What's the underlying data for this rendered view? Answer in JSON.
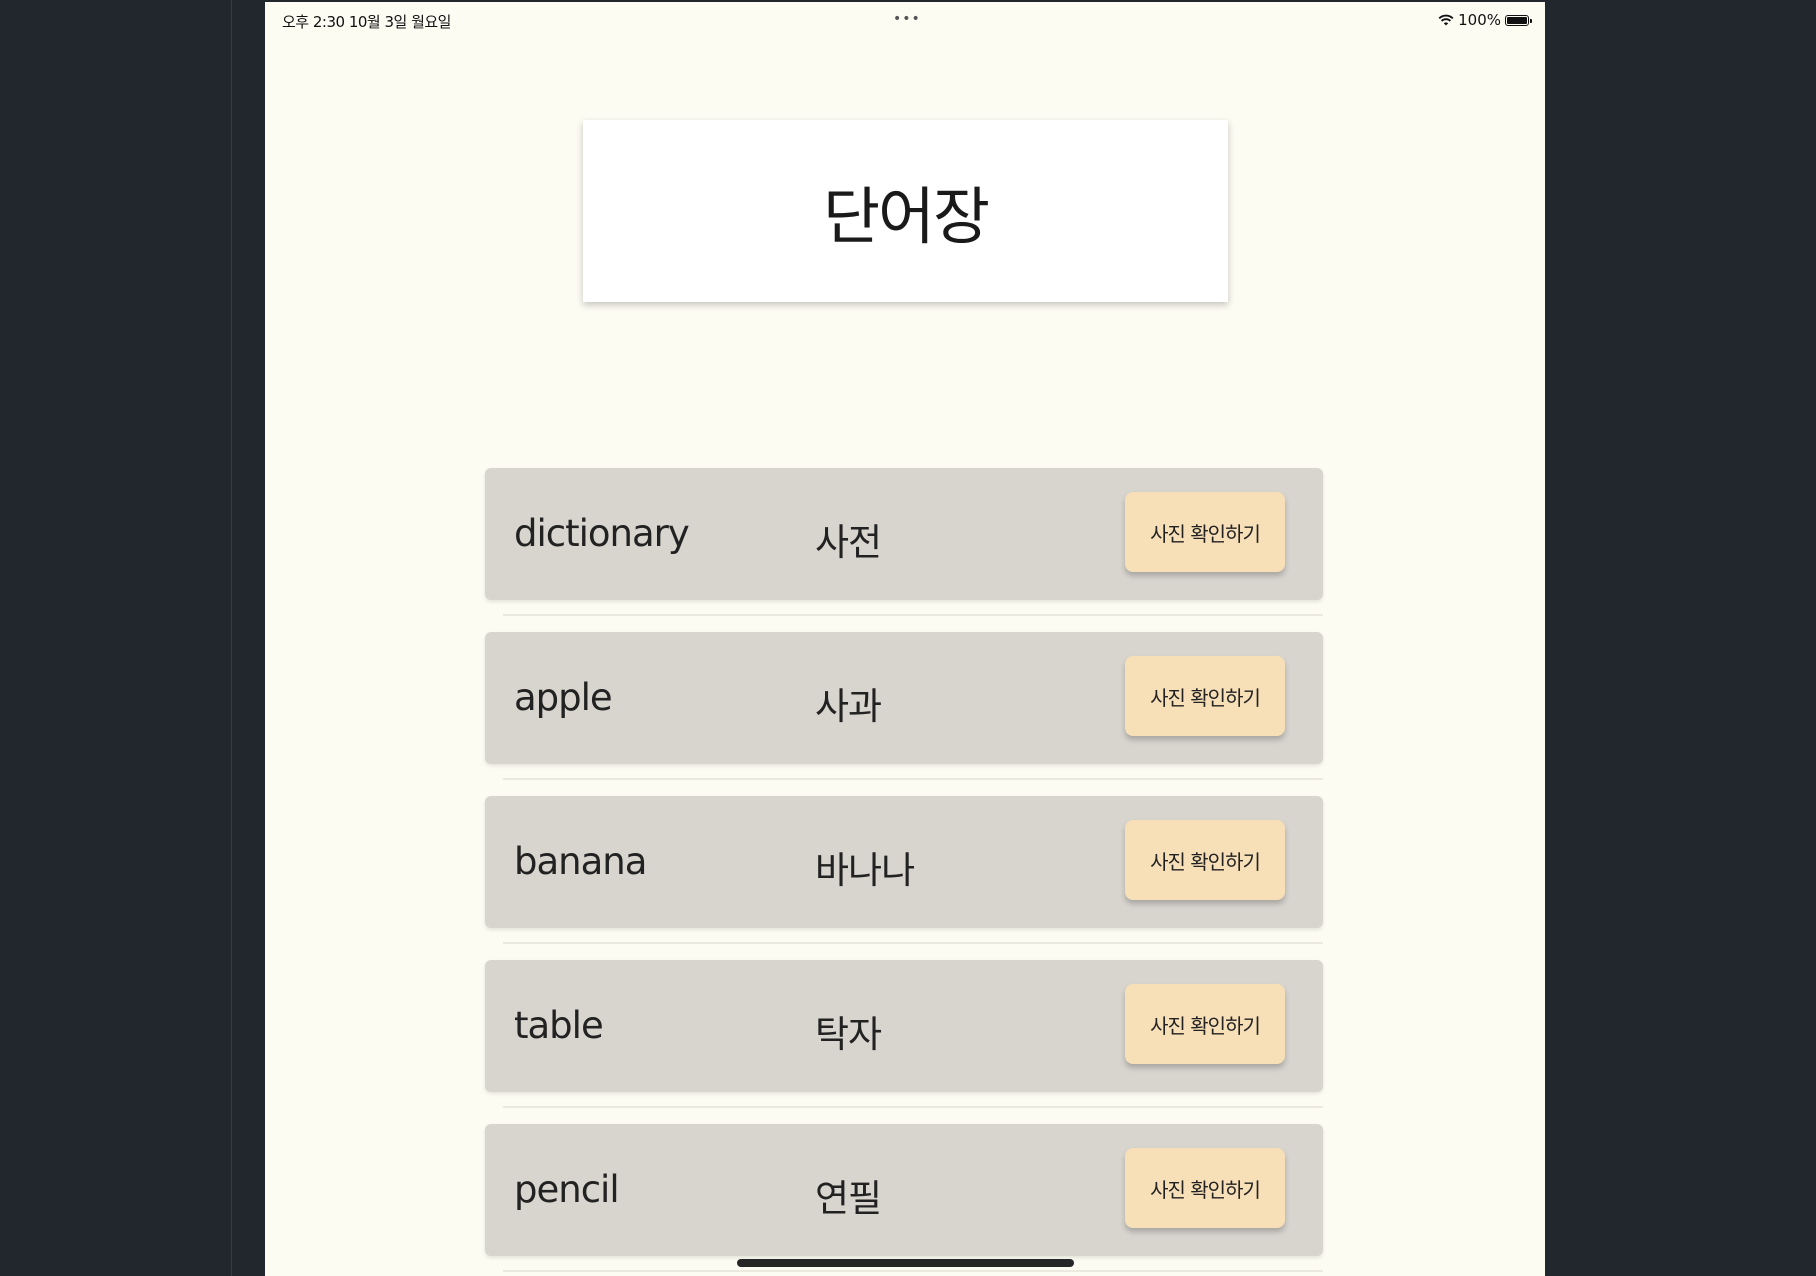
{
  "status_bar": {
    "time_date": "오후 2:30   10월 3일 월요일",
    "center_dots": "•••",
    "battery_label": "100%",
    "battery_level": 1.0
  },
  "header": {
    "title": "단어장"
  },
  "words": [
    {
      "english": "dictionary",
      "korean": "사전",
      "button_label": "사진 확인하기"
    },
    {
      "english": "apple",
      "korean": "사과",
      "button_label": "사진 확인하기"
    },
    {
      "english": "banana",
      "korean": "바나나",
      "button_label": "사진 확인하기"
    },
    {
      "english": "table",
      "korean": "탁자",
      "button_label": "사진 확인하기"
    },
    {
      "english": "pencil",
      "korean": "연필",
      "button_label": "사진 확인하기"
    }
  ],
  "colors": {
    "outer_background": "#22262d",
    "app_background": "#fdfcf3",
    "row_background": "#d8d5cf",
    "button_background": "#f7dfb8",
    "title_card": "#ffffff"
  }
}
